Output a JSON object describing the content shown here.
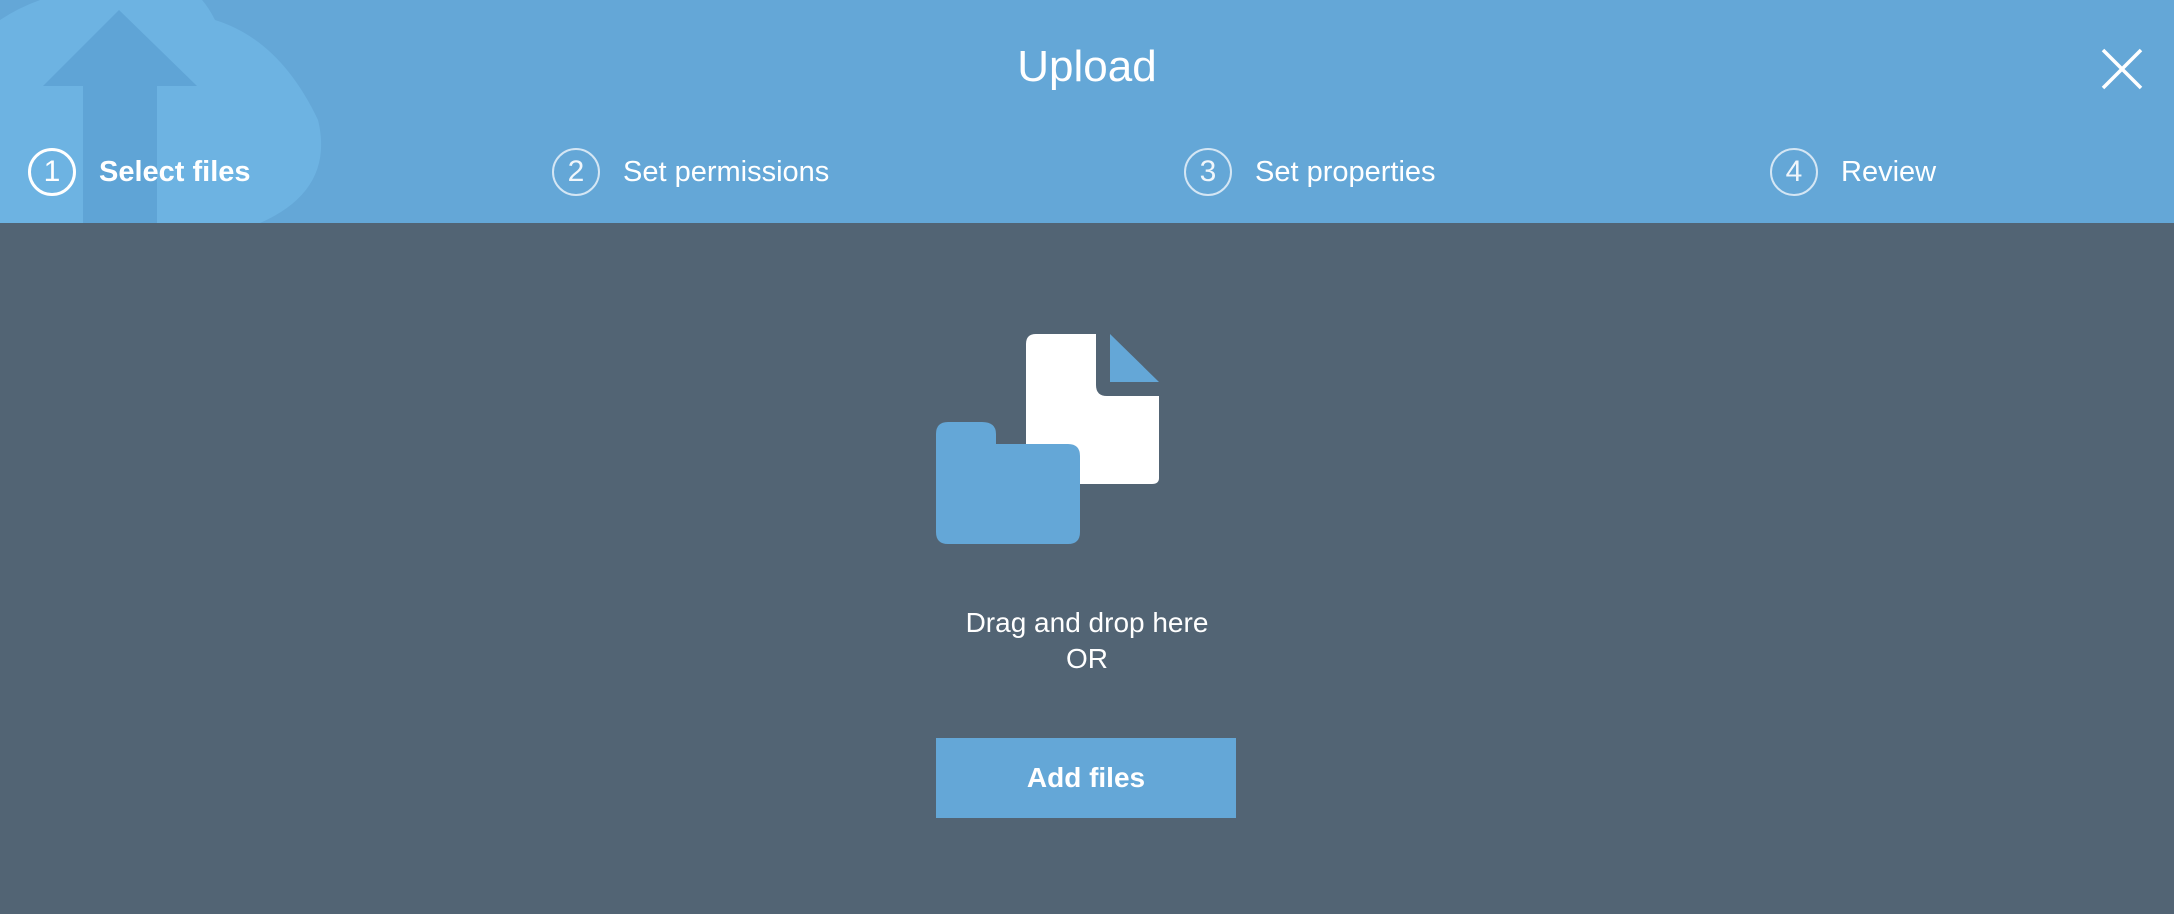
{
  "dialog": {
    "title": "Upload"
  },
  "steps": [
    {
      "number": "1",
      "label": "Select files",
      "active": true
    },
    {
      "number": "2",
      "label": "Set permissions",
      "active": false
    },
    {
      "number": "3",
      "label": "Set properties",
      "active": false
    },
    {
      "number": "4",
      "label": "Review",
      "active": false
    }
  ],
  "dropzone": {
    "instruction": "Drag and drop here",
    "separator": "OR",
    "add_button_label": "Add files",
    "icon": "file-and-folder-icon"
  },
  "colors": {
    "header_bg": "#64a7d7",
    "body_bg": "#526474",
    "accent": "#64a7d7",
    "text": "#ffffff"
  },
  "icons": {
    "close": "close-icon",
    "watermark": "upload-cloud-icon"
  }
}
